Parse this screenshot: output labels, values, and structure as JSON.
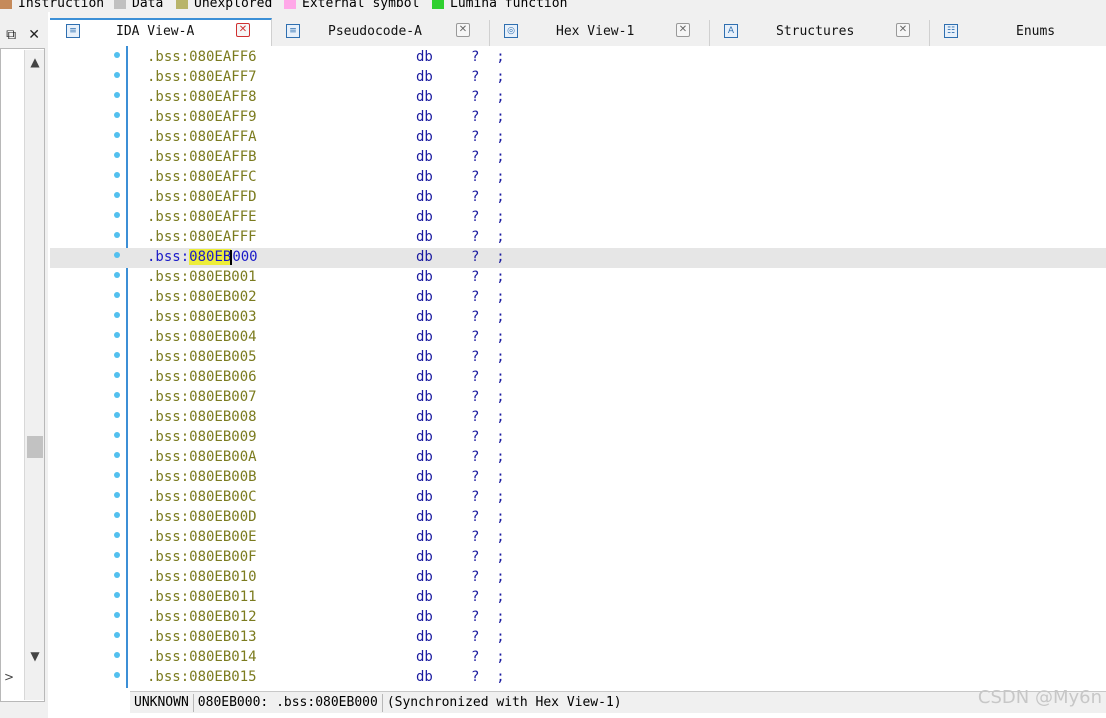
{
  "legend": {
    "items": [
      {
        "label": "Instruction",
        "color": "#c58a5a"
      },
      {
        "label": "Data",
        "color": "#c0c0c0"
      },
      {
        "label": "Unexplored",
        "color": "#b8b46a"
      },
      {
        "label": "External symbol",
        "color": "#ffa8e8"
      },
      {
        "label": "Lumina function",
        "color": "#2fd02f"
      }
    ]
  },
  "left_dock": {
    "restore_icon": "restore-window-icon",
    "close_icon": "close-icon",
    "close_glyph": "✕",
    "restore_glyph": "⧉"
  },
  "tabs": [
    {
      "label": "IDA View-A",
      "icon": "ida-view-icon",
      "active": true
    },
    {
      "label": "Pseudocode-A",
      "icon": "pseudocode-icon",
      "active": false
    },
    {
      "label": "Hex View-1",
      "icon": "hex-view-icon",
      "active": false
    },
    {
      "label": "Structures",
      "icon": "structures-icon",
      "active": false
    },
    {
      "label": "Enums",
      "icon": "enums-icon",
      "active": false
    }
  ],
  "disassembly": {
    "segment": ".bss:",
    "mnemonic": "db",
    "operand": "? ;",
    "current_row": 10,
    "highlight_text": "080EB",
    "rows": [
      "080EAFF6",
      "080EAFF7",
      "080EAFF8",
      "080EAFF9",
      "080EAFFA",
      "080EAFFB",
      "080EAFFC",
      "080EAFFD",
      "080EAFFE",
      "080EAFFF",
      "080EB000",
      "080EB001",
      "080EB002",
      "080EB003",
      "080EB004",
      "080EB005",
      "080EB006",
      "080EB007",
      "080EB008",
      "080EB009",
      "080EB00A",
      "080EB00B",
      "080EB00C",
      "080EB00D",
      "080EB00E",
      "080EB00F",
      "080EB010",
      "080EB011",
      "080EB012",
      "080EB013",
      "080EB014",
      "080EB015"
    ]
  },
  "status_bar": {
    "state": "UNKNOWN",
    "location": "080EB000: .bss:080EB000",
    "sync": "(Synchronized with Hex View-1)"
  },
  "watermark": "CSDN @My6n"
}
